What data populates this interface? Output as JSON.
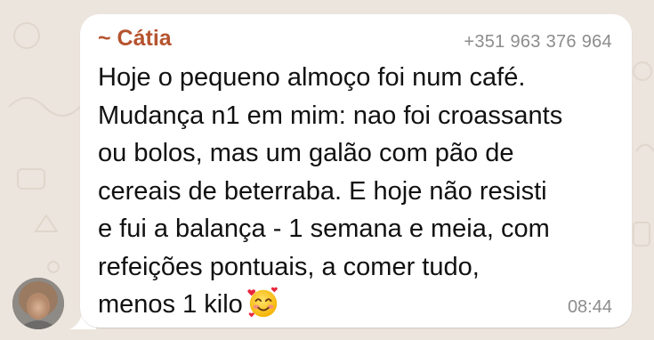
{
  "message": {
    "sender_name": "~ Cátia",
    "sender_phone": "+351 963 376 964",
    "text_lines": [
      "Hoje o pequeno almoço foi num café.",
      "Mudança n1 em mim: nao foi croassants",
      "ou bolos, mas um galão com pão de",
      "cereais de beterraba. E hoje não resisti",
      "e fui a balança - 1 semana e meia, com",
      "refeições pontuais, a comer tudo,",
      "menos 1 kilo"
    ],
    "emoji": "smiling-face-with-hearts",
    "time": "08:44"
  },
  "colors": {
    "background": "#ECE5DD",
    "bubble": "#FFFFFF",
    "sender_name": "#B5532E",
    "meta_text": "#8C8C8C",
    "message_text": "#111111"
  }
}
